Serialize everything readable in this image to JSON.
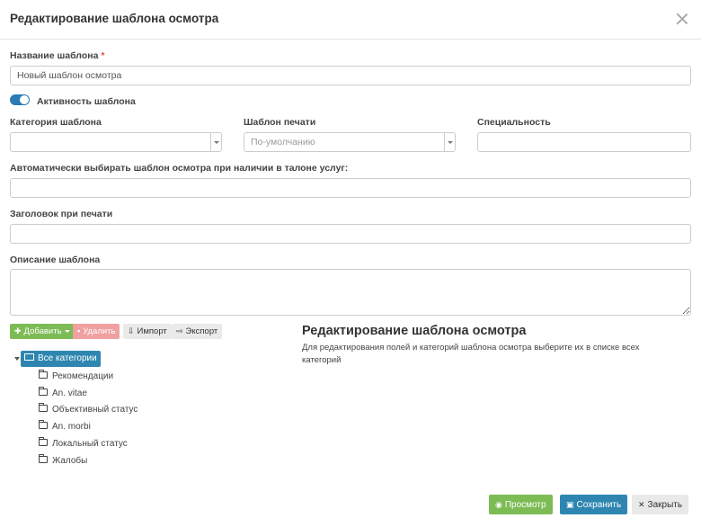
{
  "modal": {
    "title": "Редактирование шаблона осмотра"
  },
  "form": {
    "name_label": "Название шаблона",
    "required_mark": "*",
    "name_value": "Новый шаблон осмотра",
    "active_label": "Активность шаблона",
    "active": true,
    "category_label": "Категория шаблона",
    "category_value": "",
    "print_template_label": "Шаблон печати",
    "print_template_value": "По-умолчанию",
    "specialty_label": "Специальность",
    "specialty_value": "",
    "auto_select_label": "Автоматически выбирать шаблон осмотра при наличии в талоне услуг:",
    "auto_select_value": "",
    "print_header_label": "Заголовок при печати",
    "print_header_value": "",
    "description_label": "Описание шаблона",
    "description_value": ""
  },
  "toolbar": {
    "add_label": "Добавить",
    "delete_label": "Удалить",
    "import_label": "Импорт",
    "export_label": "Экспорт"
  },
  "tree": {
    "root_label": "Все категории",
    "items": [
      {
        "label": "Рекомендации"
      },
      {
        "label": "An. vitae"
      },
      {
        "label": "Объективный статус"
      },
      {
        "label": "An. morbi"
      },
      {
        "label": "Локальный статус"
      },
      {
        "label": "Жалобы"
      }
    ]
  },
  "editor_panel": {
    "title": "Редактирование шаблона осмотра",
    "description": "Для редактирования полей и категорий шаблона осмотра выберите их в списке всех категорий"
  },
  "footer": {
    "preview_label": "Просмотр",
    "save_label": "Сохранить",
    "close_label": "Закрыть"
  },
  "colors": {
    "primary": "#2e86b0",
    "success": "#7dbb55",
    "danger_disabled": "#f0a0a0",
    "toggle": "#2b7ab6"
  }
}
